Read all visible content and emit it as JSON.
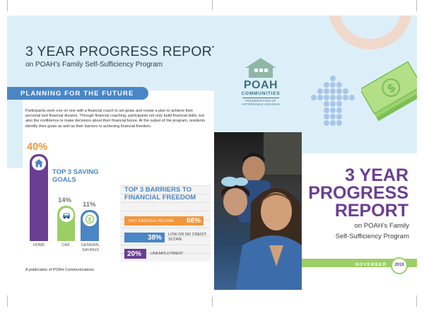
{
  "left": {
    "title": "3 YEAR PROGRESS REPORT",
    "subtitle": "on POAH’s Family Self-Sufficiency Program",
    "section_label": "PLANNING FOR THE FUTURE",
    "intro": "Participants work one on one with a financial coach to set goals and create a plan to achieve their personal and financial dreams. Through financial coaching, participants not only build financial skills, but also the confidence to make decisions about their financial future. At the outset of the program, residents identify their goals as well as their barriers to achieving financial freedom.",
    "saving_goals": {
      "title": "TOP 3 SAVING GOALS",
      "items": [
        {
          "label": "HOME",
          "pct": "40%",
          "value": 40,
          "icon": "house-icon"
        },
        {
          "label": "CAR",
          "pct": "14%",
          "value": 14,
          "icon": "car-icon"
        },
        {
          "label": "GENERAL SAVINGS",
          "pct": "11%",
          "value": 11,
          "icon": "dollar-icon"
        }
      ]
    },
    "barriers": {
      "title": "TOP 3 BARRIERS TO FINANCIAL FREEDOM",
      "items": [
        {
          "label": "NOT ENOUGH INCOME",
          "pct": "66%",
          "value": 66
        },
        {
          "label": "LOW OR NO CREDIT SCORE",
          "pct": "38%",
          "value": 38
        },
        {
          "label": "UNEMPLOYMENT",
          "pct": "20%",
          "value": 20
        }
      ]
    },
    "publication": "A publication of POAH Communications."
  },
  "right": {
    "logo_name": "POAH",
    "logo_sub": "COMMUNITIES",
    "logo_tag_1": "PRESERVATION OF",
    "logo_tag_2": "AFFORDABLE HOUSING",
    "title_1": "3 YEAR",
    "title_2": "PROGRESS",
    "title_3": "REPORT",
    "subtitle_1": "on POAH’s Family",
    "subtitle_2": "Self-Sufficiency Program",
    "month": "NOVEMBER",
    "year": "2019"
  },
  "colors": {
    "purple": "#6a3f93",
    "blue": "#4a86c5",
    "orange": "#f2963e",
    "green": "#9cce66",
    "light_blue": "#dceff9",
    "logo_teal": "#3f6f84"
  }
}
